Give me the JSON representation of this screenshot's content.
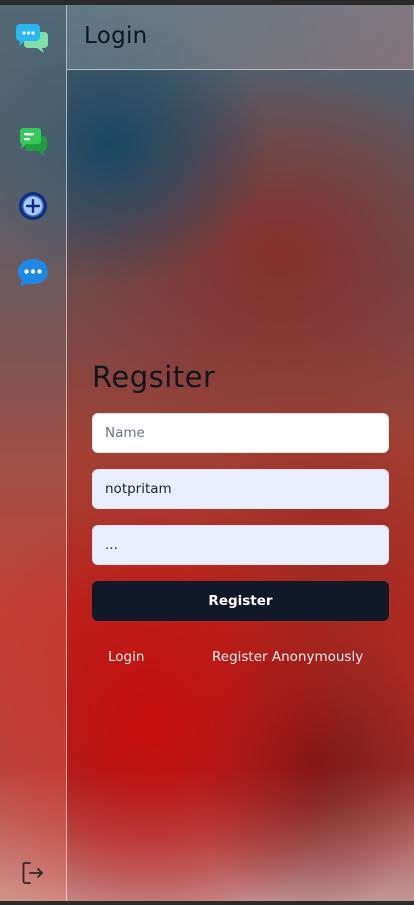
{
  "sidebar": {
    "items": [
      {
        "icon": "chat-logo-icon"
      },
      {
        "icon": "messages-icon"
      },
      {
        "icon": "add-circle-icon"
      },
      {
        "icon": "chat-bubble-dots-icon"
      }
    ],
    "logout_icon": "logout-icon"
  },
  "header": {
    "title": "Login"
  },
  "form": {
    "title": "Regsiter",
    "name_placeholder": "Name",
    "username_value": "notpritam",
    "password_value": "...",
    "register_label": "Register",
    "login_link": "Login",
    "anonymous_link": "Register Anonymously"
  },
  "colors": {
    "button_bg": "#111827",
    "field_autofill_bg": "#e8eefc",
    "accent_blue": "#1e88e5",
    "accent_green": "#2fbf4f"
  }
}
